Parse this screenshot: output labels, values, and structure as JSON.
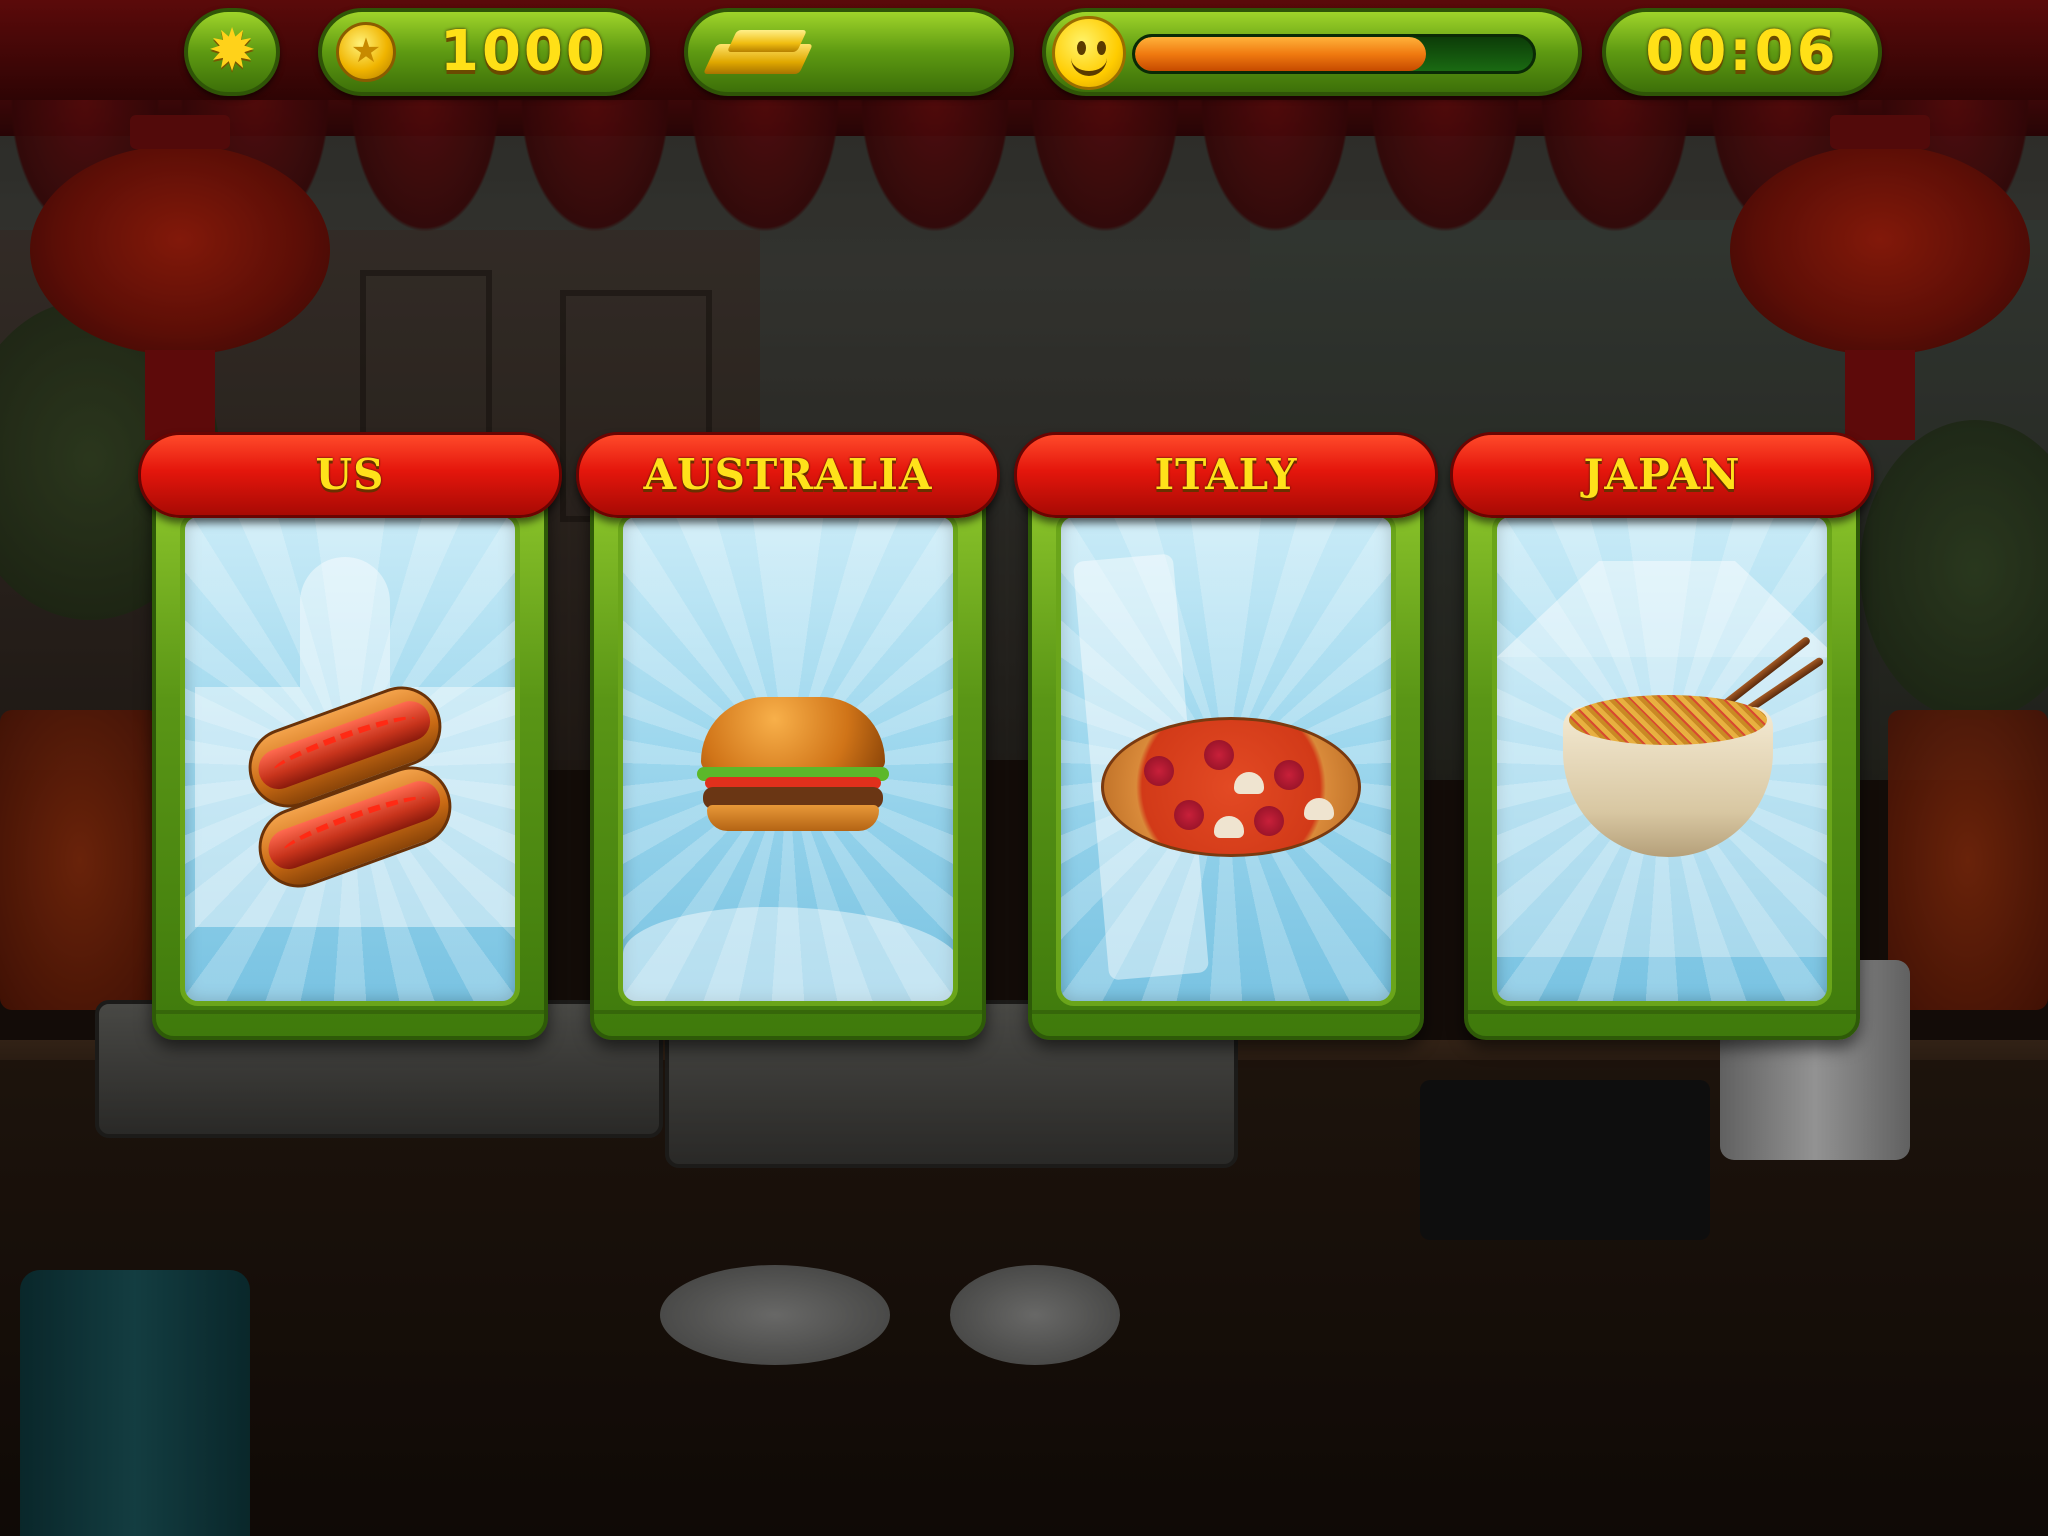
{
  "hud": {
    "settings_icon": "gear-icon",
    "coins": {
      "icon": "coin-icon",
      "value": "1000"
    },
    "gold": {
      "icon": "gold-bar-icon",
      "value": ""
    },
    "happiness": {
      "icon": "smiley-icon",
      "fill_fraction": 0.73
    },
    "timer": "00:06"
  },
  "levels": [
    {
      "label": "US",
      "food": "hotdog",
      "landmark": "capitol-building"
    },
    {
      "label": "AUSTRALIA",
      "food": "burger",
      "landmark": "sydney-opera-house"
    },
    {
      "label": "ITALY",
      "food": "pizza",
      "landmark": "leaning-tower-of-pisa"
    },
    {
      "label": "JAPAN",
      "food": "noodles",
      "landmark": "pagoda"
    }
  ],
  "colors": {
    "hud_green": "#6aa51a",
    "banner_red": "#e4160c",
    "label_yellow": "#ffe21a",
    "bar_orange": "#f07a10"
  }
}
